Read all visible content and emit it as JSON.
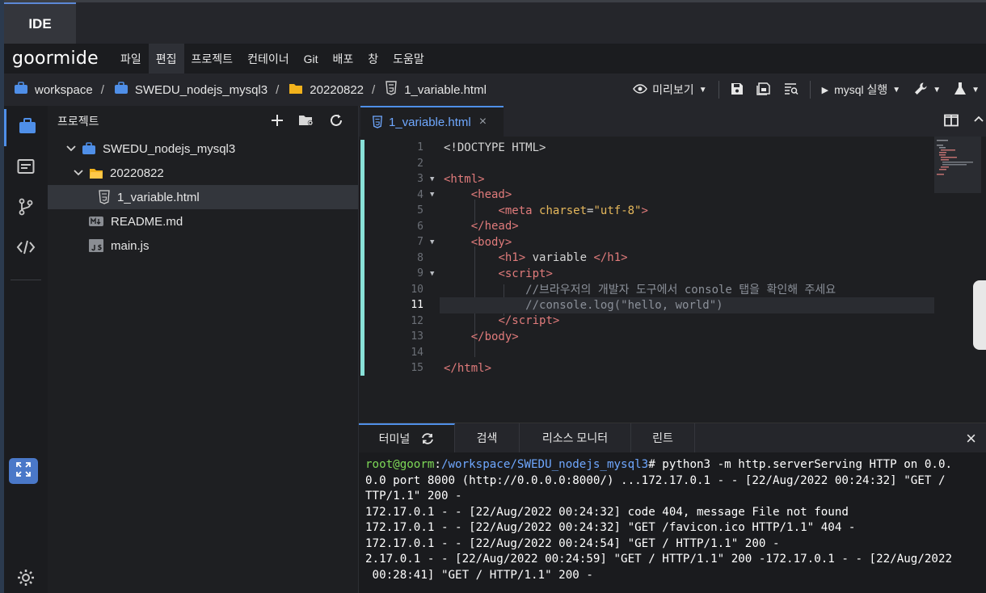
{
  "app": {
    "tab_label": "IDE",
    "logo": "goormide"
  },
  "menu": [
    "파일",
    "편집",
    "프로젝트",
    "컨테이너",
    "Git",
    "배포",
    "창",
    "도움말"
  ],
  "menu_active_index": 1,
  "breadcrumb": {
    "workspace": "workspace",
    "project": "SWEDU_nodejs_mysql3",
    "folder": "20220822",
    "file": "1_variable.html",
    "separator": "/"
  },
  "toolbar": {
    "preview": "미리보기",
    "run": "mysql 실행"
  },
  "project_panel": {
    "title": "프로젝트",
    "tree": [
      {
        "label": "SWEDU_nodejs_mysql3",
        "icon": "briefcase-icon",
        "expanded": true
      },
      {
        "label": "20220822",
        "icon": "folder-icon",
        "expanded": true
      },
      {
        "label": "1_variable.html",
        "icon": "html-file-icon",
        "selected": true
      },
      {
        "label": "README.md",
        "icon": "md-file-icon"
      },
      {
        "label": "main.js",
        "icon": "js-file-icon"
      }
    ]
  },
  "editor": {
    "tab_label": "1_variable.html",
    "tab_close": "×",
    "current_line": 11,
    "line_numbers": [
      "1",
      "2",
      "3",
      "4",
      "5",
      "6",
      "7",
      "8",
      "9",
      "10",
      "11",
      "12",
      "13",
      "14",
      "15"
    ]
  },
  "terminal": {
    "tabs": [
      "터미널",
      "검색",
      "리소스 모니터",
      "린트"
    ],
    "close": "×",
    "prompt_user": "root@goorm",
    "prompt_colon": ":",
    "prompt_path": "/workspace/SWEDU_nodejs_mysql3",
    "prompt_cmd": "# python3 -m http.serverServing HTTP on 0.0.",
    "lines": [
      "0.0 port 8000 (http://0.0.0.0:8000/) ...172.17.0.1 - - [22/Aug/2022 00:24:32] \"GET /",
      "TTP/1.1\" 200 -",
      "172.17.0.1 - - [22/Aug/2022 00:24:32] code 404, message File not found",
      "172.17.0.1 - - [22/Aug/2022 00:24:32] \"GET /favicon.ico HTTP/1.1\" 404 -",
      "172.17.0.1 - - [22/Aug/2022 00:24:54] \"GET / HTTP/1.1\" 200 -",
      "2.17.0.1 - - [22/Aug/2022 00:24:59] \"GET / HTTP/1.1\" 200 -172.17.0.1 - - [22/Aug/2022",
      " 00:28:41] \"GET / HTTP/1.1\" 200 -"
    ]
  }
}
